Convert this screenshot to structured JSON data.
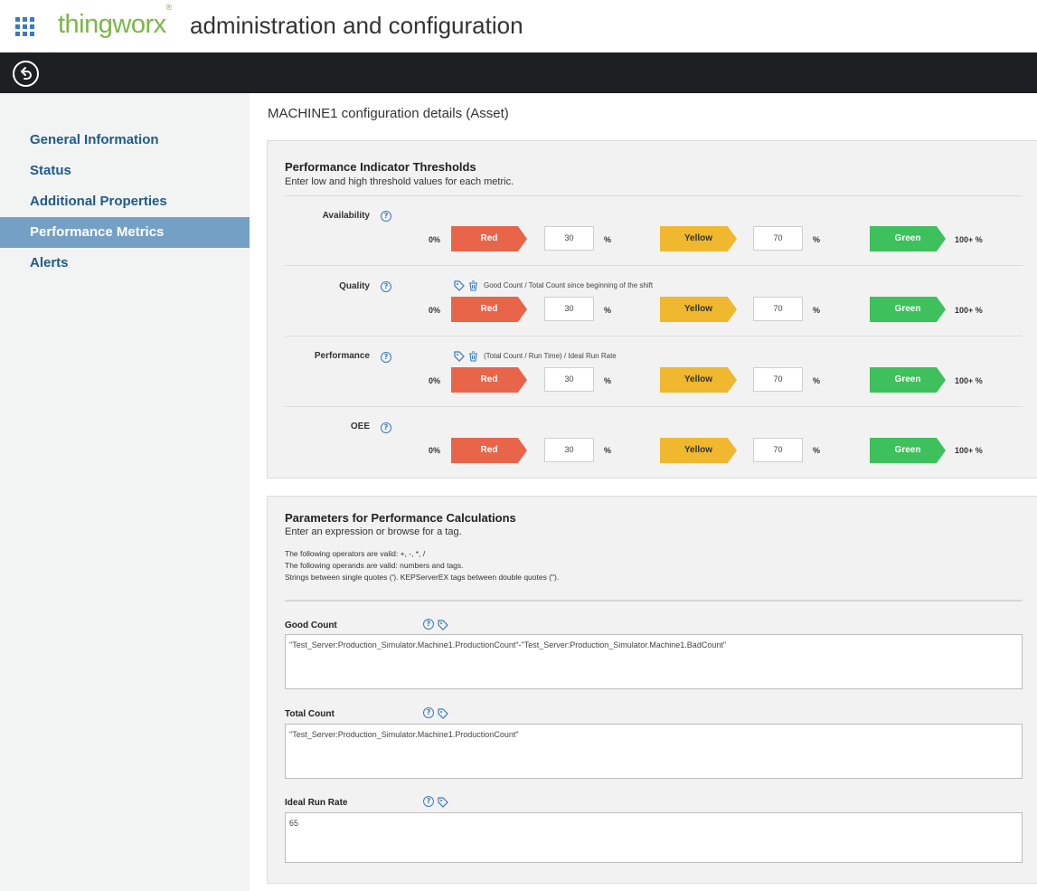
{
  "header": {
    "brand": "thingworx",
    "brand_mark": "®",
    "title": "administration and configuration"
  },
  "sidebar": {
    "items": [
      {
        "label": "General Information",
        "active": false
      },
      {
        "label": "Status",
        "active": false
      },
      {
        "label": "Additional Properties",
        "active": false
      },
      {
        "label": "Performance Metrics",
        "active": true
      },
      {
        "label": "Alerts",
        "active": false
      }
    ]
  },
  "page": {
    "title": "MACHINE1 configuration details (Asset)"
  },
  "thresholds": {
    "title": "Performance Indicator Thresholds",
    "subtitle": "Enter low and high threshold values for each metric.",
    "help_glyph": "?",
    "metrics": [
      {
        "name": "Availability",
        "formula": "",
        "low_label": "0%",
        "red": "Red",
        "low_value": "30",
        "unit": "%",
        "yellow": "Yellow",
        "high_value": "70",
        "green": "Green",
        "high_label": "100+ %"
      },
      {
        "name": "Quality",
        "formula": "Good Count / Total Count since beginning of the shift",
        "low_label": "0%",
        "red": "Red",
        "low_value": "30",
        "unit": "%",
        "yellow": "Yellow",
        "high_value": "70",
        "green": "Green",
        "high_label": "100+ %"
      },
      {
        "name": "Performance",
        "formula": "(Total Count / Run Time) / Ideal Run Rate",
        "low_label": "0%",
        "red": "Red",
        "low_value": "30",
        "unit": "%",
        "yellow": "Yellow",
        "high_value": "70",
        "green": "Green",
        "high_label": "100+ %"
      },
      {
        "name": "OEE",
        "formula": "",
        "low_label": "0%",
        "red": "Red",
        "low_value": "30",
        "unit": "%",
        "yellow": "Yellow",
        "high_value": "70",
        "green": "Green",
        "high_label": "100+ %"
      }
    ]
  },
  "parameters": {
    "title": "Parameters for Performance Calculations",
    "subtitle": "Enter an expression or browse for a tag.",
    "notes": [
      "The following operators are valid: +, -, *, /",
      "The following operands are valid: numbers and tags.",
      "Strings between single quotes ('). KEPServerEX tags between double quotes (\")."
    ],
    "fields": [
      {
        "label": "Good Count",
        "value": "\"Test_Server:Production_Simulator.Machine1.ProductionCount\"-\"Test_Server:Production_Simulator.Machine1.BadCount\""
      },
      {
        "label": "Total Count",
        "value": "\"Test_Server:Production_Simulator.Machine1.ProductionCount\""
      },
      {
        "label": "Ideal Run Rate",
        "value": "65"
      }
    ]
  },
  "colors": {
    "brand_green": "#7ab648",
    "nav_dark": "#1c2023",
    "link_blue": "#1e5b8a",
    "active_bg": "#75a0c5",
    "red": "#e8654a",
    "yellow": "#efb82e",
    "green": "#3ec05c"
  },
  "icons": [
    "apps-grid-icon",
    "back-icon",
    "help-icon",
    "tag-icon",
    "trash-icon"
  ]
}
